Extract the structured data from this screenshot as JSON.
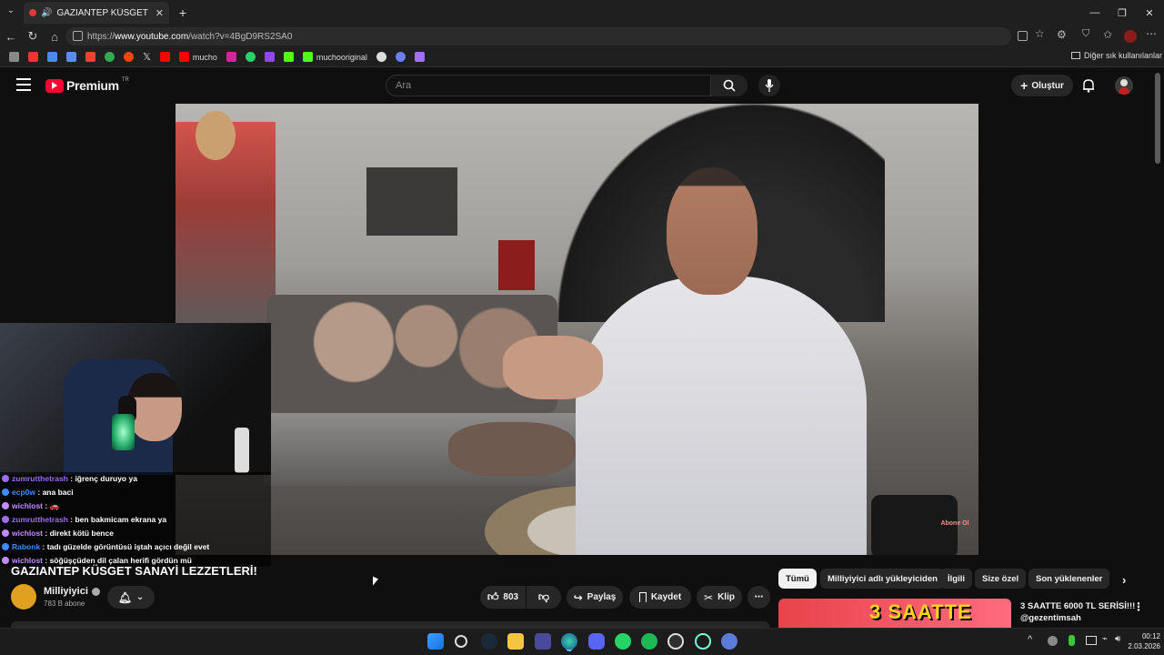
{
  "browser": {
    "tab_title": "GAZIANTEP KÜSGET SANAYİ LE",
    "url_prefix": "https://",
    "url_host": "www.youtube.com",
    "url_path": "/watch?v=4BgD9RS2SA0",
    "bookmarks": [
      "mucho",
      "muchooriginal"
    ],
    "other_bookmarks": "Diğer sık kullanılanlar"
  },
  "youtube": {
    "logo_text": "Premium",
    "logo_region": "TR",
    "search_placeholder": "Ara",
    "create_label": "Oluştur"
  },
  "video": {
    "title": "GAZIANTEP KÜSGET SANAYİ LEZZETLERİ!",
    "channel_name": "Milliyiyici",
    "subscribers": "783 B abone",
    "likes": "803",
    "share_label": "Paylaş",
    "save_label": "Kaydet",
    "clip_label": "Klip",
    "overlay_badge": "Abone Ol"
  },
  "chat": [
    {
      "user": "zumrutthetrash",
      "msg": "iğrenç duruyo ya",
      "color": "#9b6cf0"
    },
    {
      "user": "ecp0w",
      "msg": "ana baci",
      "color": "#3b8cff"
    },
    {
      "user": "wichlost",
      "msg": "🚗",
      "color": "#c08cff"
    },
    {
      "user": "zumrutthetrash",
      "msg": "ben bakmicam ekrana ya",
      "color": "#9b6cf0"
    },
    {
      "user": "wichlost",
      "msg": "direkt kötü bence",
      "color": "#c08cff"
    },
    {
      "user": "Rabonk",
      "msg": "tadı güzelde görüntüsü iştah açıcı değil evet",
      "color": "#3b8cff"
    },
    {
      "user": "wichlost",
      "msg": "söğüşçüden dil çalan herifi gördün mü",
      "color": "#c08cff"
    }
  ],
  "chips": [
    "Tümü",
    "Milliyiyici adlı yükleyiciden",
    "İlgili",
    "Size özel",
    "Son yüklenenler"
  ],
  "recommendation": {
    "thumb_text": "3 SAATTE",
    "title": "3 SAATTE 6000 TL SERİSİ!!!",
    "channel": "@gezentimsah"
  },
  "taskbar": {
    "time": "00:12",
    "date": "2.03.2026"
  },
  "colors": {
    "yt_red": "#ff0033",
    "bg": "#0f0f0f",
    "chip_bg": "#272727"
  }
}
